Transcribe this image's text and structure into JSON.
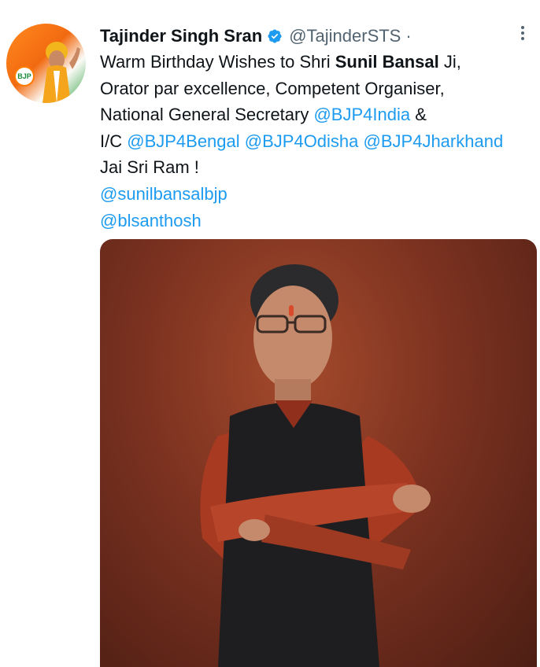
{
  "author": {
    "name": "Tajinder Singh Sran",
    "handle": "@TajinderSTS",
    "separator": "·",
    "avatar_logo_text": "BJP"
  },
  "tweet": {
    "line1_pre": "Warm Birthday Wishes to Shri ",
    "line1_bold": "Sunil Bansal",
    "line1_post": " Ji,",
    "line2": "Orator par excellence, Competent Organiser,",
    "line3_pre": "National General Secretary ",
    "line3_mention": "@BJP4India",
    "line3_post": " &",
    "line4_pre": "I/C ",
    "line4_m1": "@BJP4Bengal",
    "line4_m2": "@BJP4Odisha",
    "line4_m3": "@BJP4Jharkhand",
    "line5": "Jai Sri Ram !",
    "line6": "@sunilbansalbjp",
    "line7": "@blsanthosh"
  },
  "icons": {
    "verified": "verified-badge-icon",
    "more": "more-options-icon"
  },
  "colors": {
    "link": "#1d9bf0",
    "secondary_text": "#536471",
    "photo_background": "#7c3220",
    "verified": "#1d9bf0"
  }
}
